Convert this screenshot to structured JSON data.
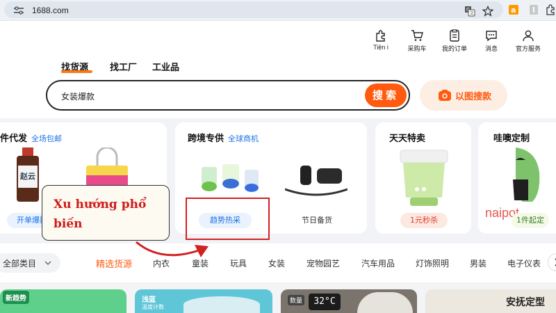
{
  "browser": {
    "url": "1688.com",
    "icons": [
      "site-settings-icon",
      "translate-icon",
      "bookmark-star-icon",
      "amazon-extension-icon",
      "extension-icon",
      "extensions-puzzle-icon"
    ]
  },
  "topnav": {
    "items": [
      {
        "label": "Tiện i",
        "icon": "puzzle-icon"
      },
      {
        "label": "采购车",
        "icon": "cart-icon"
      },
      {
        "label": "我的订单",
        "icon": "order-icon"
      },
      {
        "label": "消息",
        "icon": "message-icon"
      },
      {
        "label": "官方服务",
        "icon": "user-icon"
      }
    ]
  },
  "tabs": [
    "找货源",
    "找工厂",
    "工业品"
  ],
  "search": {
    "value": "女装爆款",
    "button": "搜索",
    "image_search": "以图搜款"
  },
  "cards": [
    {
      "title": "件代发",
      "subtitle": "全场包邮",
      "pill": "开单爆款"
    },
    {
      "title": "跨境专供",
      "subtitle": "全球商机",
      "pill": "趋势热采",
      "pill2": "节日备货"
    },
    {
      "title": "天天特卖",
      "subtitle": "",
      "pill": "1元秒杀"
    },
    {
      "title": "哇噢定制",
      "subtitle": "",
      "pill": "1件起定",
      "brand": "naipot"
    }
  ],
  "annotation": {
    "text": "Xu hướng phổ biến"
  },
  "categories": {
    "all": "全部类目",
    "items": [
      "精选货源",
      "内衣",
      "童装",
      "玩具",
      "女装",
      "宠物园艺",
      "汽车用品",
      "灯饰照明",
      "男装",
      "电子仪表"
    ]
  },
  "bottom": {
    "badge1": "新趋势",
    "badge2": "浅蓝",
    "badge2_sub": "温度计数",
    "thumb3": "32°C",
    "thumb3_badge": "数量",
    "thumb4": "安抚定型"
  },
  "colors": {
    "accent": "#ff5a0e",
    "link": "#1a73e8",
    "annotation": "#d11a1a"
  }
}
